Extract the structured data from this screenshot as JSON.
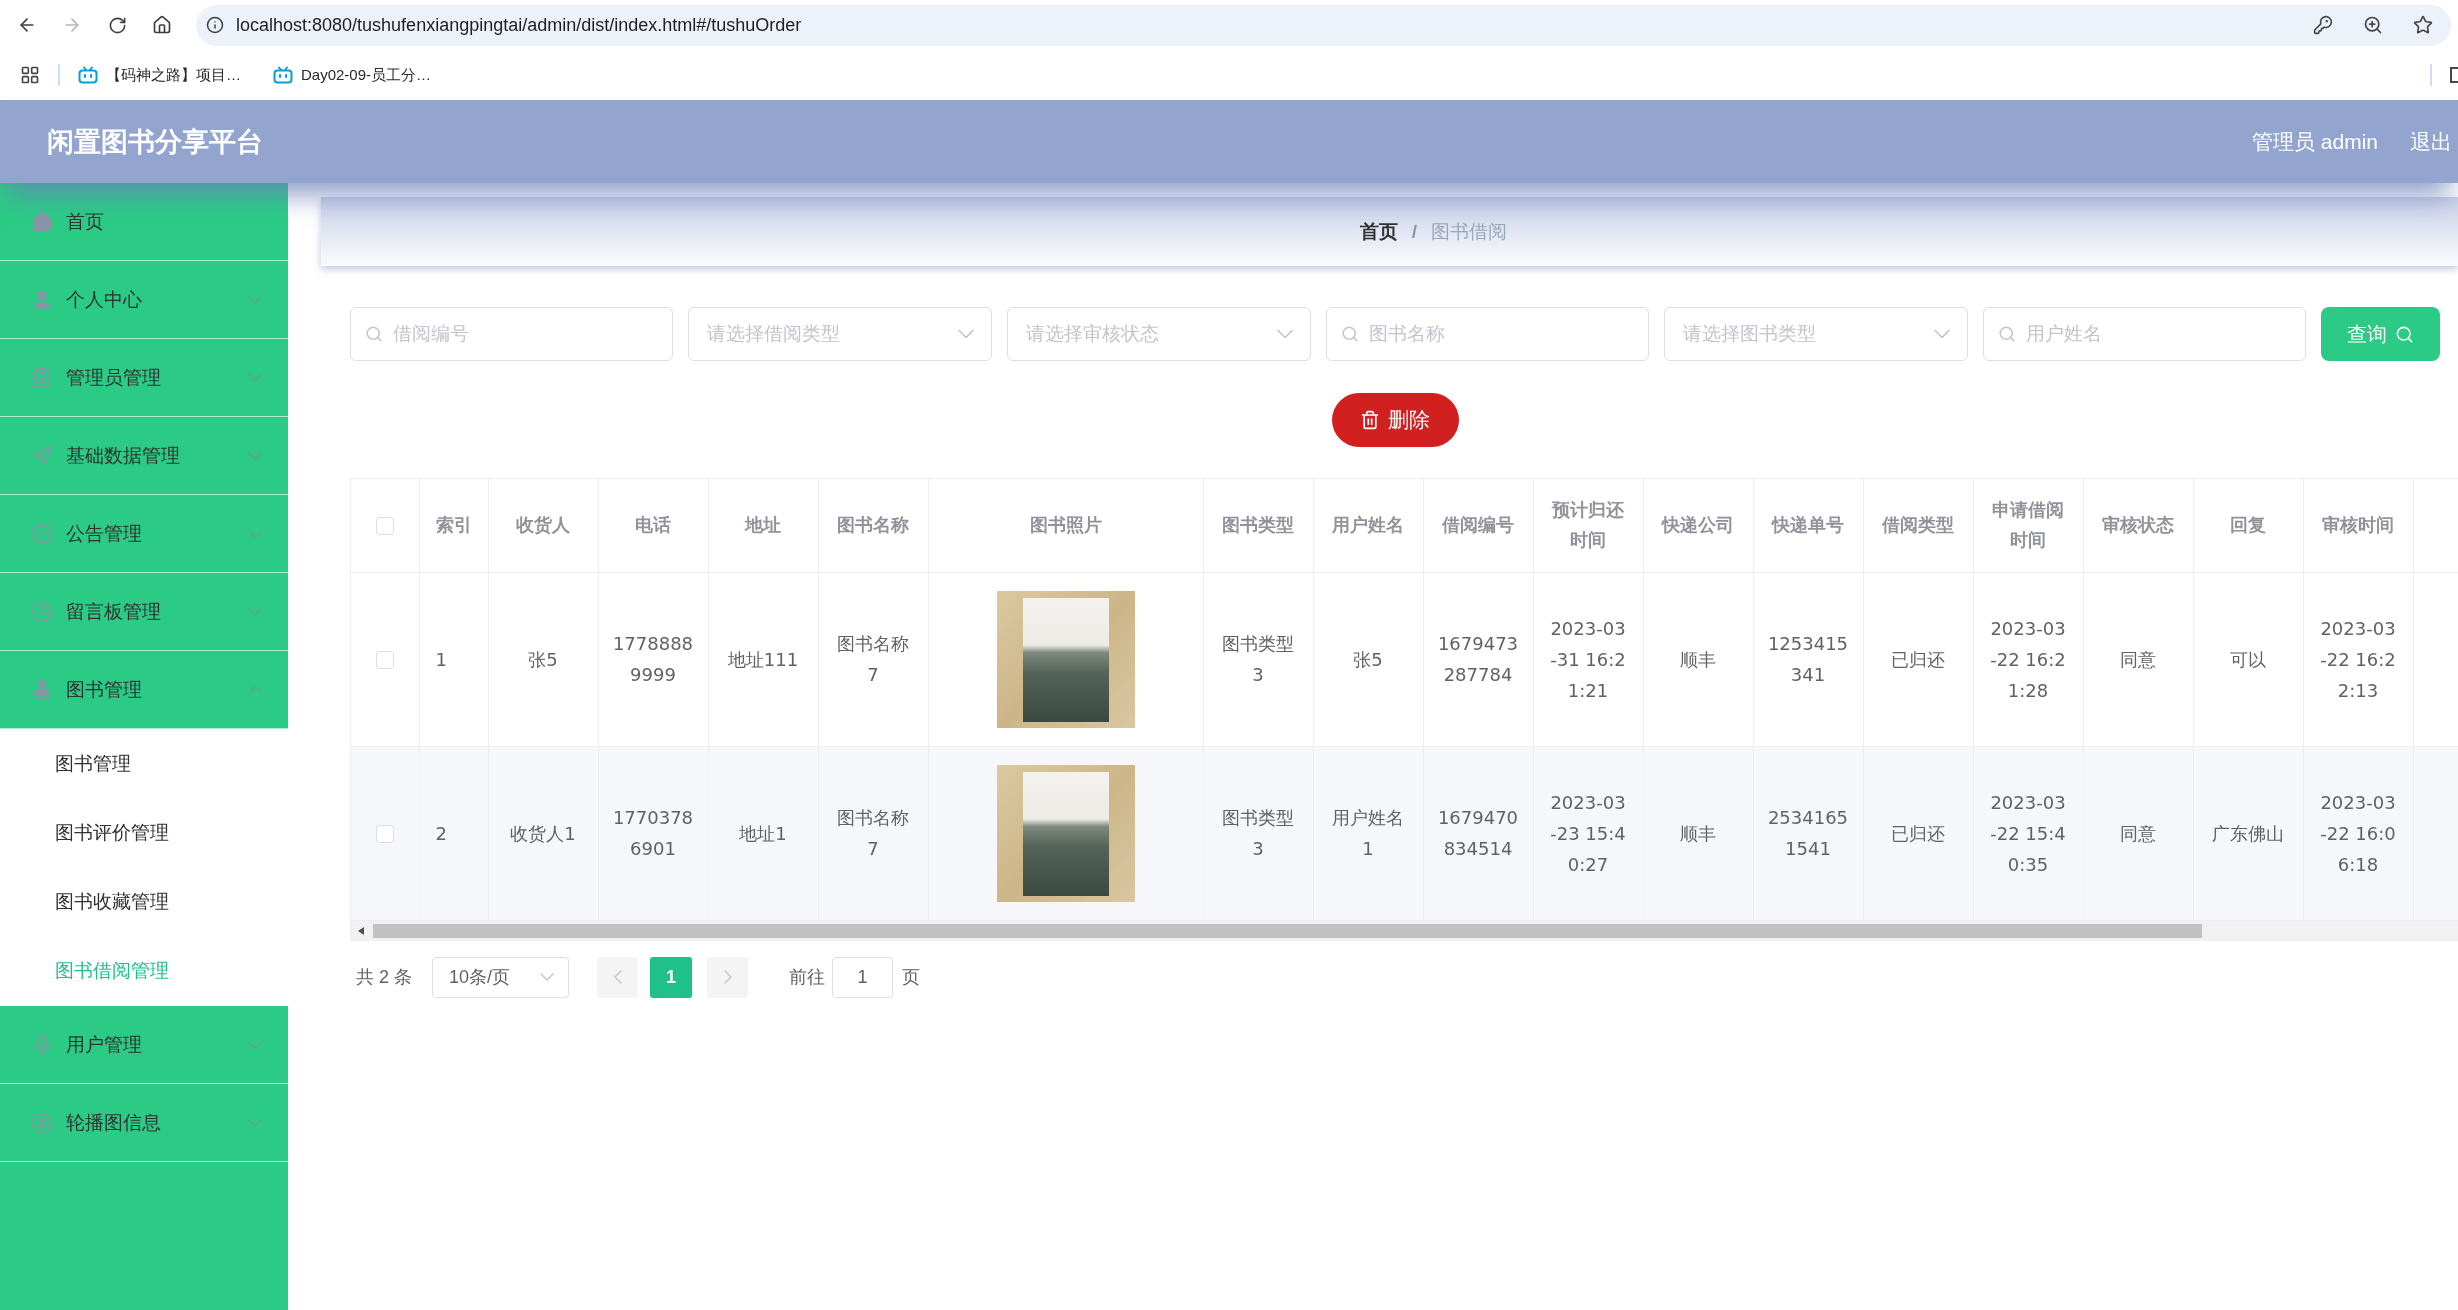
{
  "browser": {
    "back_disabled": false,
    "forward_disabled": true,
    "url": "localhost:8080/tushufenxiangpingtai/admin/dist/index.html#/tushuOrder",
    "bookmarks": [
      "【码神之路】项目…",
      "Day02-09-员工分…"
    ]
  },
  "header": {
    "title": "闲置图书分享平台",
    "user": "管理员 admin",
    "logout": "退出"
  },
  "sidebar": {
    "items": [
      {
        "label": "首页"
      },
      {
        "label": "个人中心",
        "expanded": false
      },
      {
        "label": "管理员管理",
        "expanded": false
      },
      {
        "label": "基础数据管理",
        "expanded": false
      },
      {
        "label": "公告管理",
        "expanded": false
      },
      {
        "label": "留言板管理",
        "expanded": false
      },
      {
        "label": "图书管理",
        "expanded": true,
        "children": [
          {
            "label": "图书管理",
            "selected": false
          },
          {
            "label": "图书评价管理",
            "selected": false
          },
          {
            "label": "图书收藏管理",
            "selected": false
          },
          {
            "label": "图书借阅管理",
            "selected": true
          }
        ]
      },
      {
        "label": "用户管理",
        "expanded": false
      },
      {
        "label": "轮播图信息",
        "expanded": false
      }
    ]
  },
  "breadcrumb": {
    "items": [
      "首页",
      "图书借阅"
    ],
    "separator": "/"
  },
  "filters": [
    {
      "kind": "input",
      "placeholder": "借阅编号"
    },
    {
      "kind": "select",
      "placeholder": "请选择借阅类型"
    },
    {
      "kind": "select",
      "placeholder": "请选择审核状态"
    },
    {
      "kind": "input",
      "placeholder": "图书名称"
    },
    {
      "kind": "select",
      "placeholder": "请选择图书类型"
    },
    {
      "kind": "input",
      "placeholder": "用户姓名"
    }
  ],
  "search_button": "查询",
  "delete_button": "删除",
  "table": {
    "all_checked": false,
    "columns": [
      {
        "label": "索引",
        "kind": "index"
      },
      {
        "label": "收货人",
        "kind": "text"
      },
      {
        "label": "电话",
        "kind": "text"
      },
      {
        "label": "地址",
        "kind": "text"
      },
      {
        "label": "图书名称",
        "kind": "text"
      },
      {
        "label": "图书照片",
        "kind": "photo"
      },
      {
        "label": "图书类型",
        "kind": "text"
      },
      {
        "label": "用户姓名",
        "kind": "text"
      },
      {
        "label": "借阅编号",
        "kind": "text"
      },
      {
        "label": "预计归还时间",
        "kind": "text"
      },
      {
        "label": "快递公司",
        "kind": "text"
      },
      {
        "label": "快递单号",
        "kind": "text"
      },
      {
        "label": "借阅类型",
        "kind": "text"
      },
      {
        "label": "申请借阅时间",
        "kind": "text"
      },
      {
        "label": "审核状态",
        "kind": "text"
      },
      {
        "label": "回复",
        "kind": "text"
      },
      {
        "label": "审核时间",
        "kind": "text"
      }
    ],
    "rows": [
      {
        "checked": false,
        "cells": [
          "1",
          "张5",
          "17788889999",
          "地址111",
          "图书名称7",
          "",
          "图书类型3",
          "张5",
          "1679473287784",
          "2023-03-31 16:21:21",
          "顺丰",
          "1253415341",
          "已归还",
          "2023-03-22 16:21:28",
          "同意",
          "可以",
          "2023-03-22 16:22:13"
        ]
      },
      {
        "checked": false,
        "cells": [
          "2",
          "收货人1",
          "17703786901",
          "地址1",
          "图书名称7",
          "",
          "图书类型3",
          "用户姓名1",
          "1679470834514",
          "2023-03-23 15:40:27",
          "顺丰",
          "25341651541",
          "已归还",
          "2023-03-22 15:40:35",
          "同意",
          "广东佛山",
          "2023-03-22 16:06:18"
        ]
      }
    ]
  },
  "pagination": {
    "total": "共 2 条",
    "page_size": "10条/页",
    "prev_disabled": true,
    "pages": [
      {
        "label": "1",
        "selected": true
      }
    ],
    "next_disabled": true,
    "goto_label": "前往",
    "goto_value": "1",
    "goto_suffix": "页"
  }
}
